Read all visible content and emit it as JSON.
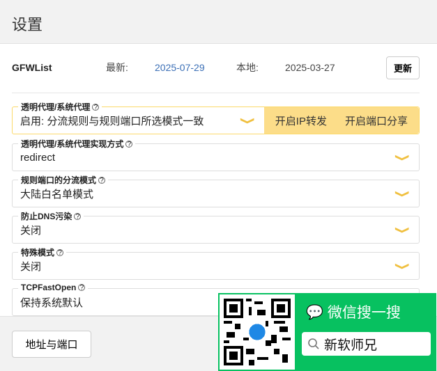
{
  "header": {
    "title": "设置"
  },
  "gfwlist": {
    "name": "GFWList",
    "latest_label": "最新:",
    "latest_date": "2025-07-29",
    "local_label": "本地:",
    "local_date": "2025-03-27",
    "update_button": "更新"
  },
  "fields": [
    {
      "label": "透明代理/系统代理",
      "value": "启用: 分流规则与规则端口所选模式一致",
      "buttons": [
        "开启IP转发",
        "开启端口分享"
      ]
    },
    {
      "label": "透明代理/系统代理实现方式",
      "value": "redirect"
    },
    {
      "label": "规则端口的分流模式",
      "value": "大陆白名单模式"
    },
    {
      "label": "防止DNS污染",
      "value": "关闭"
    },
    {
      "label": "特殊模式",
      "value": "关闭"
    },
    {
      "label": "TCPFastOpen",
      "value": "保持系统默认"
    }
  ],
  "footer": {
    "address_button": "地址与端口"
  },
  "promo": {
    "title": "微信搜一搜",
    "search_text": "新软师兄",
    "accent": "#07c160"
  }
}
